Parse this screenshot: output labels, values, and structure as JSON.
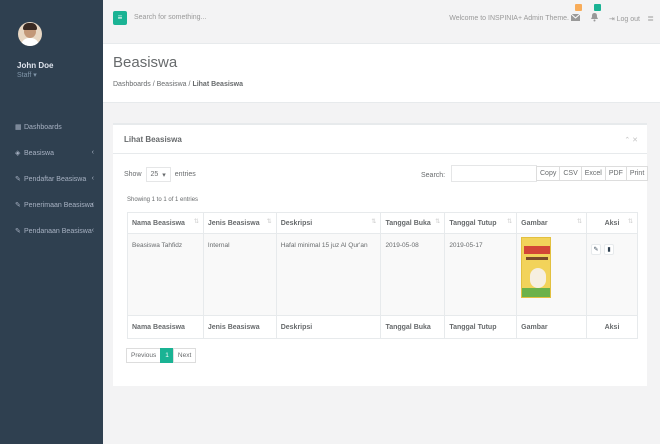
{
  "user": {
    "name": "John Doe",
    "role": "Staff ▾"
  },
  "sidebar": {
    "items": [
      {
        "label": "Dashboards",
        "icon": "grid-icon",
        "arrow": ""
      },
      {
        "label": "Beasiswa",
        "icon": "diamond-icon",
        "arrow": "‹"
      },
      {
        "label": "Pendaftar Beasiswa",
        "icon": "pencil-icon",
        "arrow": "‹"
      },
      {
        "label": "Penerimaan Beasiswa",
        "icon": "pencil-icon",
        "arrow": "‹"
      },
      {
        "label": "Pendanaan Beasiswa",
        "icon": "pencil-icon",
        "arrow": "‹"
      }
    ]
  },
  "topbar": {
    "search_placeholder": "Search for something...",
    "welcome": "Welcome to INSPINIA+ Admin Theme.",
    "logout": "Log out",
    "colors": {
      "accent": "#1ab394",
      "warning": "#f8ac59",
      "primary": "#1ab394"
    }
  },
  "page": {
    "title": "Beasiswa",
    "breadcrumb": {
      "root": "Dashboards",
      "mid": "Beasiswa",
      "active": "Lihat Beasiswa",
      "sep": "/"
    }
  },
  "ibox": {
    "title": "Lihat Beasiswa",
    "tools": "⌃ ✕"
  },
  "controls": {
    "show": "Show",
    "entries_value": "25",
    "entries": "entries",
    "search": "Search:",
    "buttons": [
      "Copy",
      "CSV",
      "Excel",
      "PDF",
      "Print"
    ]
  },
  "info": "Showing 1 to 1 of 1 entries",
  "table": {
    "headers": [
      "Nama Beasiswa",
      "Jenis Beasiswa",
      "Deskripsi",
      "Tanggal Buka",
      "Tanggal Tutup",
      "Gambar",
      "Aksi"
    ],
    "rows": [
      {
        "nama": "Beasiswa Tahfidz",
        "jenis": "Internal",
        "deskripsi": "Hafal minimal 15 juz Al Qur'an",
        "buka": "2019-05-08",
        "tutup": "2019-05-17"
      }
    ]
  },
  "pagination": {
    "previous": "Previous",
    "current": "1",
    "next": "Next"
  }
}
